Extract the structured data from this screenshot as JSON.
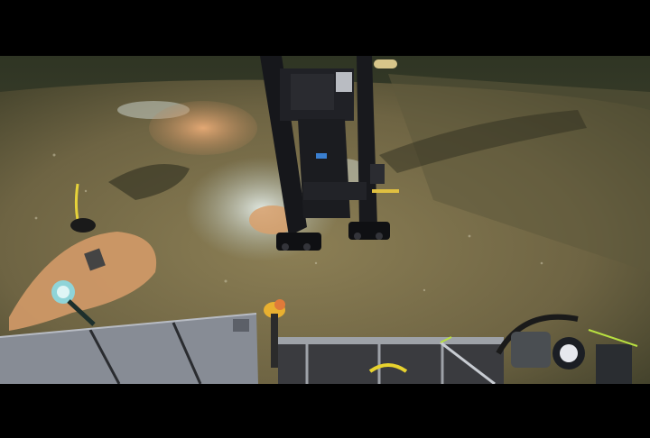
{
  "image": {
    "kind": "seafloor-photograph",
    "letterbox_color": "#000000",
    "sediment_color": "#7a6f48",
    "water_color": "#3b3f2a",
    "bacterial_mat_color": "#d9a06c",
    "white_mat_color": "#c9d4cc",
    "apparatus_color": "#15161a",
    "skid_color": "#8a8f98",
    "handle_color": "#e0c040"
  }
}
